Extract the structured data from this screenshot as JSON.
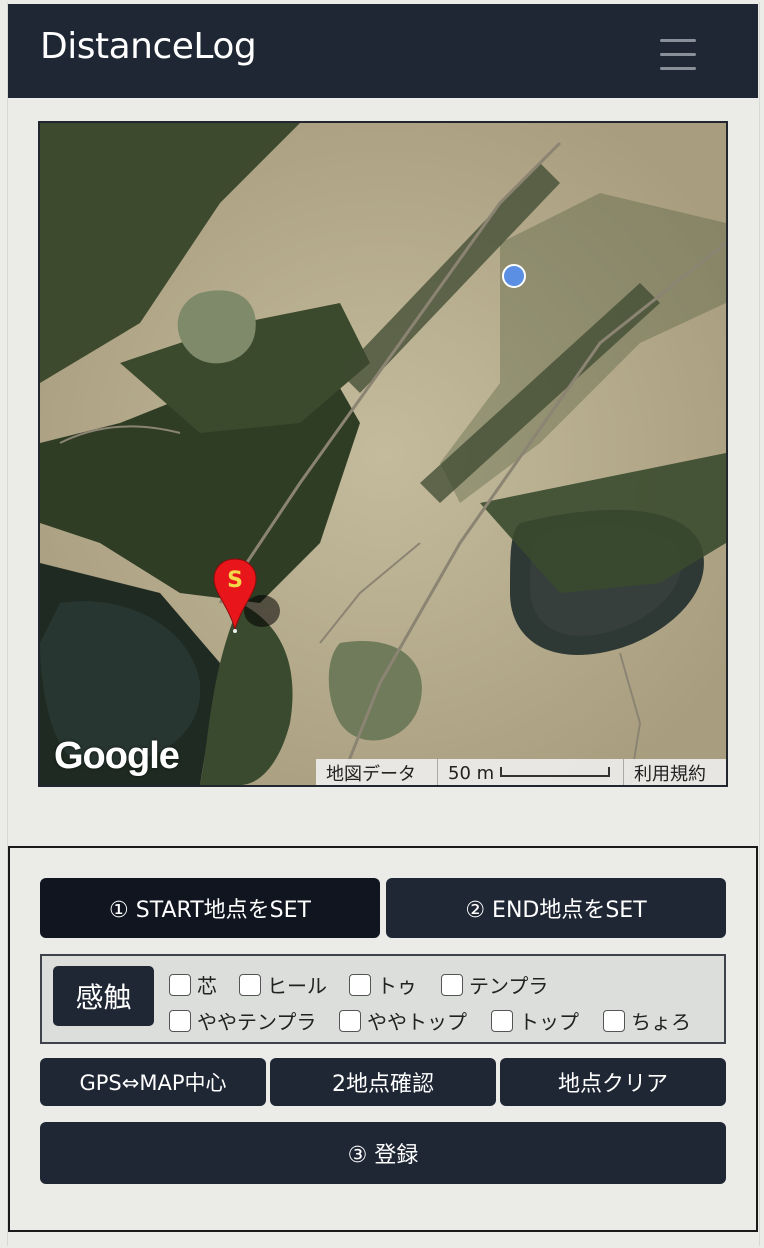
{
  "navbar": {
    "brand": "DistanceLog",
    "menu_icon": "hamburger-icon"
  },
  "map": {
    "logo": "Google",
    "map_data_label": "地図データ",
    "scale_label": "50 m",
    "terms_label": "利用規約",
    "start_marker_label": "S",
    "marker_color": "#e8161a",
    "location_dot_color": "#5a8fe4"
  },
  "controls": {
    "start_button": "① START地点をSET",
    "end_button": "② END地点をSET",
    "touch_label": "感触",
    "feel_options": [
      "芯",
      "ヒール",
      "トゥ",
      "テンプラ",
      "ややテンプラ",
      "ややトップ",
      "トップ",
      "ちょろ"
    ],
    "gps_center_button": "GPS⇔MAP中心",
    "confirm_button": "2地点確認",
    "clear_button": "地点クリア",
    "register_button": "③ 登録"
  },
  "colors": {
    "navbar_bg": "#1f2634",
    "button_bg": "#1f2634",
    "page_bg": "#ebebe7"
  }
}
